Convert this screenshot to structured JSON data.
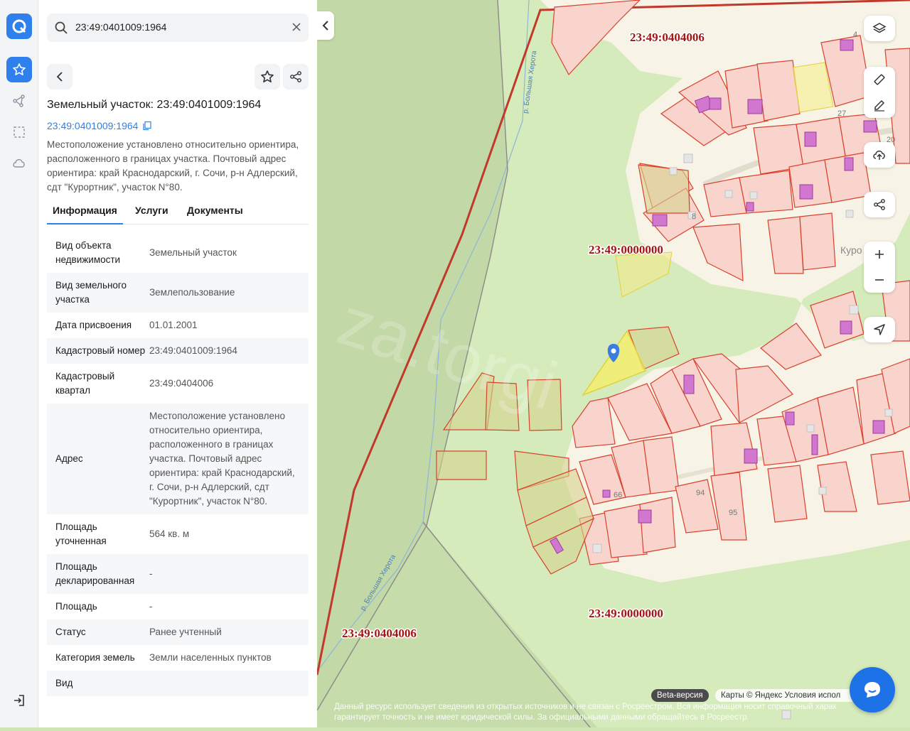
{
  "search": {
    "query": "23:49:0401009:1964"
  },
  "object": {
    "title": "Земельный участок: 23:49:0401009:1964",
    "cadastral_link": "23:49:0401009:1964",
    "description": "Местоположение установлено относительно ориентира, расположенного в границах участка. Почтовый адрес ориентира: край Краснодарский, г. Сочи, р-н Адлерский, сдт \"Курортник\", участок N°80."
  },
  "tabs": [
    {
      "label": "Информация",
      "active": true
    },
    {
      "label": "Услуги"
    },
    {
      "label": "Документы"
    }
  ],
  "info_rows": [
    {
      "key": "Вид объекта недвижимости",
      "value": "Земельный участок"
    },
    {
      "key": "Вид земельного участка",
      "value": "Землепользование"
    },
    {
      "key": "Дата присвоения",
      "value": "01.01.2001"
    },
    {
      "key": "Кадастровый номер",
      "value": "23:49:0401009:1964"
    },
    {
      "key": "Кадастровый квартал",
      "value": "23:49:0404006"
    },
    {
      "key": "Адрес",
      "value": "Местоположение установлено относительно ориентира, расположенного в границах участка. Почтовый адрес ориентира: край Краснодарский, г. Сочи, р-н Адлерский, сдт \"Курортник\", участок N°80."
    },
    {
      "key": "Площадь уточненная",
      "value": "564 кв. м"
    },
    {
      "key": "Площадь декларированная",
      "value": "-"
    },
    {
      "key": "Площадь",
      "value": "-"
    },
    {
      "key": "Статус",
      "value": "Ранее учтенный"
    },
    {
      "key": "Категория земель",
      "value": "Земли населенных пунктов"
    },
    {
      "key": "Вид",
      "value": ""
    }
  ],
  "map": {
    "labels": {
      "quarter_top": "23:49:0404006",
      "quarter_mid": "23:49:0000000",
      "quarter_bottom": "23:49:0000000",
      "quarter_left": "23:49:0404006",
      "river_top": "р. Большая Херота",
      "river_bottom": "р. Большая Херота",
      "settlement": "Куро",
      "n27": "27",
      "n20": "20",
      "n4": "4",
      "n8": "8",
      "n66": "66",
      "n94": "94",
      "n95": "95"
    },
    "beta_label": "Beta-версия",
    "copyright": "Карты © Яндекс   Условия испол",
    "disclaimer": "Данный ресурс использует сведения из открытых источников и не связан с Росреестром. Вся информация носит справочный харак гарантирует точность и не имеет юридической силы. За официальными данными обращайтесь в Росреестр.",
    "watermark": "za.torgi",
    "colors": {
      "accent": "#2f80ed",
      "parcel_stroke": "#d9412e",
      "parcel_fill": "#f8d4cd",
      "building": "#c94fc0",
      "selected": "#f4e24a",
      "quarter_label": "#a31512",
      "forest": "#c6dfa7",
      "dark_forest": "#b4ce97"
    }
  },
  "icons": [
    "logo-icon",
    "star-icon",
    "route-icon",
    "select-area-icon",
    "cloud-icon",
    "logout-icon",
    "search-icon",
    "clear-icon",
    "back-icon",
    "favorite-icon",
    "share-icon",
    "copy-icon",
    "collapse-icon",
    "layers-icon",
    "ruler-icon",
    "edit-icon",
    "upload-icon",
    "share-map-icon",
    "zoom-in-icon",
    "zoom-out-icon",
    "locate-icon",
    "chat-icon",
    "map-pin-icon"
  ]
}
